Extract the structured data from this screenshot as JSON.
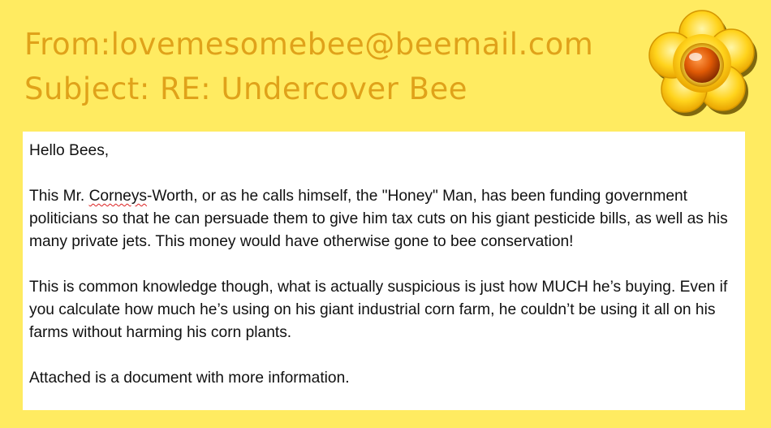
{
  "email": {
    "from": "From:lovemesomebee@beemail.com",
    "subject": "Subject: RE: Undercover Bee",
    "greeting": "Hello Bees,",
    "paragraph1": {
      "pre": "This Mr. ",
      "flagged_word": "Corneys",
      "post": "-Worth, or as he calls himself, the \"Honey\" Man, has been funding government politicians so that he can persuade them to give him tax cuts on his giant pesticide bills, as well as his many private jets. This money would have otherwise gone to bee conservation!"
    },
    "paragraph2": "This is common knowledge though, what is actually suspicious is just how MUCH he’s buying. Even if you calculate how much he’s using on his giant industrial corn farm, he couldn’t be using it all on his farms without harming his corn plants.",
    "paragraph3": "Attached is a document with more information."
  },
  "colors": {
    "background": "#ffeb61",
    "header_text": "#e0a21a",
    "card": "#ffffff",
    "flower_petal": "#ffd21a",
    "flower_center": "#d94a00",
    "spellcheck_underline": "#d22"
  },
  "icons": {
    "flower": "flower-icon",
    "spellcheck": "spellcheck-squiggle"
  }
}
